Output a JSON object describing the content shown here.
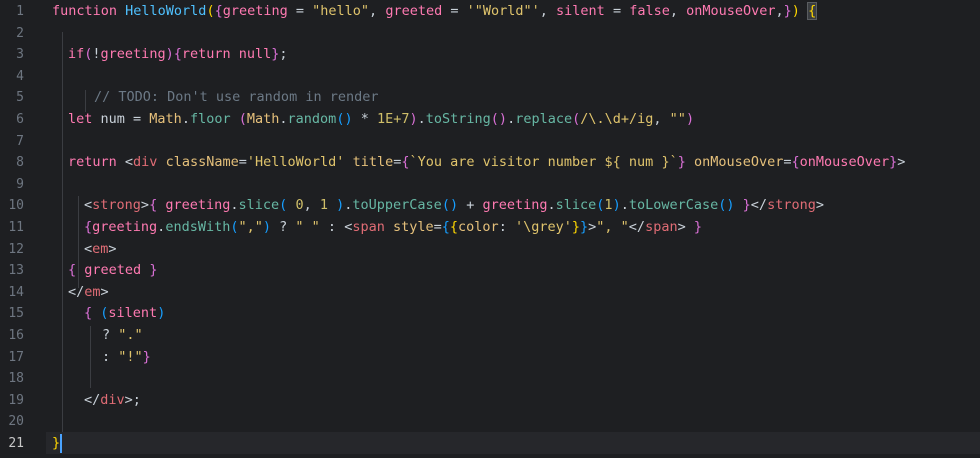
{
  "editor": {
    "language": "javascript",
    "active_line": 21,
    "line_numbers": [
      "1",
      "2",
      "3",
      "4",
      "5",
      "6",
      "7",
      "8",
      "9",
      "10",
      "11",
      "12",
      "13",
      "14",
      "15",
      "16",
      "17",
      "18",
      "19",
      "20",
      "21"
    ],
    "lines": [
      [
        [
          "kw",
          "function "
        ],
        [
          "fnname",
          "HelloWorld"
        ],
        [
          "br1",
          "("
        ],
        [
          "br2",
          "{"
        ],
        [
          "param",
          "greeting"
        ],
        [
          "plain",
          " = "
        ],
        [
          "str",
          "\"hello\""
        ],
        [
          "plain",
          ", "
        ],
        [
          "param",
          "greeted"
        ],
        [
          "plain",
          " = "
        ],
        [
          "str",
          "'\"World\"'"
        ],
        [
          "plain",
          ", "
        ],
        [
          "param",
          "silent"
        ],
        [
          "plain",
          " = "
        ],
        [
          "kw",
          "false"
        ],
        [
          "plain",
          ", "
        ],
        [
          "param",
          "onMouseOver"
        ],
        [
          "plain",
          ","
        ],
        [
          "br2",
          "}"
        ],
        [
          "br1",
          ")"
        ],
        [
          "plain",
          " "
        ],
        [
          "br1",
          "{"
        ]
      ],
      [],
      [
        [
          "kw",
          "if"
        ],
        [
          "br2",
          "("
        ],
        [
          "plain",
          "!"
        ],
        [
          "param",
          "greeting"
        ],
        [
          "br2",
          ")"
        ],
        [
          "br2",
          "{"
        ],
        [
          "kw",
          "return "
        ],
        [
          "kw",
          "null"
        ],
        [
          "br2",
          "}"
        ],
        [
          "plain",
          ";"
        ]
      ],
      [],
      [
        [
          "cmt",
          "// TODO: Don't use random in render"
        ]
      ],
      [
        [
          "kw",
          "let "
        ],
        [
          "plain",
          "num = "
        ],
        [
          "cls",
          "Math"
        ],
        [
          "plain",
          "."
        ],
        [
          "fn",
          "floor"
        ],
        [
          "plain",
          " "
        ],
        [
          "br2",
          "("
        ],
        [
          "cls",
          "Math"
        ],
        [
          "plain",
          "."
        ],
        [
          "fn",
          "random"
        ],
        [
          "br3",
          "()"
        ],
        [
          "plain",
          " * "
        ],
        [
          "num",
          "1E+7"
        ],
        [
          "br2",
          ")"
        ],
        [
          "plain",
          "."
        ],
        [
          "fn",
          "toString"
        ],
        [
          "br2",
          "()"
        ],
        [
          "plain",
          "."
        ],
        [
          "fn",
          "replace"
        ],
        [
          "br2",
          "("
        ],
        [
          "str",
          "/\\.\\d+/ig"
        ],
        [
          "plain",
          ", "
        ],
        [
          "str",
          "\"\""
        ],
        [
          "br2",
          ")"
        ]
      ],
      [],
      [
        [
          "kw",
          "return "
        ],
        [
          "plain",
          "<"
        ],
        [
          "tag",
          "div"
        ],
        [
          "plain",
          " "
        ],
        [
          "attr",
          "className"
        ],
        [
          "plain",
          "="
        ],
        [
          "str",
          "'HelloWorld'"
        ],
        [
          "plain",
          " "
        ],
        [
          "attr",
          "title"
        ],
        [
          "plain",
          "="
        ],
        [
          "br2",
          "{"
        ],
        [
          "str",
          "`You are visitor number ${ num }`"
        ],
        [
          "br2",
          "}"
        ],
        [
          "plain",
          " "
        ],
        [
          "attr",
          "onMouseOver"
        ],
        [
          "plain",
          "="
        ],
        [
          "br2",
          "{"
        ],
        [
          "param",
          "onMouseOver"
        ],
        [
          "br2",
          "}"
        ],
        [
          "plain",
          ">"
        ]
      ],
      [],
      [
        [
          "plain",
          "<"
        ],
        [
          "tag",
          "strong"
        ],
        [
          "plain",
          ">"
        ],
        [
          "br2",
          "{"
        ],
        [
          "plain",
          " "
        ],
        [
          "param",
          "greeting"
        ],
        [
          "plain",
          "."
        ],
        [
          "fn",
          "slice"
        ],
        [
          "br3",
          "("
        ],
        [
          "plain",
          " "
        ],
        [
          "num",
          "0"
        ],
        [
          "plain",
          ", "
        ],
        [
          "num",
          "1"
        ],
        [
          "plain",
          " "
        ],
        [
          "br3",
          ")"
        ],
        [
          "plain",
          "."
        ],
        [
          "fn",
          "toUpperCase"
        ],
        [
          "br3",
          "()"
        ],
        [
          "plain",
          " + "
        ],
        [
          "param",
          "greeting"
        ],
        [
          "plain",
          "."
        ],
        [
          "fn",
          "slice"
        ],
        [
          "br3",
          "("
        ],
        [
          "num",
          "1"
        ],
        [
          "br3",
          ")"
        ],
        [
          "plain",
          "."
        ],
        [
          "fn",
          "toLowerCase"
        ],
        [
          "br3",
          "()"
        ],
        [
          "plain",
          " "
        ],
        [
          "br2",
          "}"
        ],
        [
          "plain",
          "</"
        ],
        [
          "tag",
          "strong"
        ],
        [
          "plain",
          ">"
        ]
      ],
      [
        [
          "br2",
          "{"
        ],
        [
          "param",
          "greeting"
        ],
        [
          "plain",
          "."
        ],
        [
          "fn",
          "endsWith"
        ],
        [
          "br3",
          "("
        ],
        [
          "str",
          "\",\""
        ],
        [
          "br3",
          ")"
        ],
        [
          "plain",
          " ? "
        ],
        [
          "str",
          "\" \""
        ],
        [
          "plain",
          " : "
        ],
        [
          "plain",
          "<"
        ],
        [
          "tag",
          "span"
        ],
        [
          "plain",
          " "
        ],
        [
          "attr",
          "style"
        ],
        [
          "plain",
          "="
        ],
        [
          "br3",
          "{"
        ],
        [
          "br1",
          "{"
        ],
        [
          "attr",
          "color"
        ],
        [
          "plain",
          ": "
        ],
        [
          "str",
          "'\\grey'"
        ],
        [
          "br1",
          "}"
        ],
        [
          "br3",
          "}"
        ],
        [
          "plain",
          ">"
        ],
        [
          "str",
          "\", \""
        ],
        [
          "plain",
          "</"
        ],
        [
          "tag",
          "span"
        ],
        [
          "plain",
          "> "
        ],
        [
          "br2",
          "}"
        ]
      ],
      [
        [
          "plain",
          "<"
        ],
        [
          "tag",
          "em"
        ],
        [
          "plain",
          ">"
        ]
      ],
      [
        [
          "br2",
          "{"
        ],
        [
          "plain",
          " "
        ],
        [
          "param",
          "greeted"
        ],
        [
          "plain",
          " "
        ],
        [
          "br2",
          "}"
        ]
      ],
      [
        [
          "plain",
          "</"
        ],
        [
          "tag",
          "em"
        ],
        [
          "plain",
          ">"
        ]
      ],
      [
        [
          "br2",
          "{"
        ],
        [
          "plain",
          " "
        ],
        [
          "br3",
          "("
        ],
        [
          "param",
          "silent"
        ],
        [
          "br3",
          ")"
        ]
      ],
      [
        [
          "plain",
          "? "
        ],
        [
          "str",
          "\".\""
        ]
      ],
      [
        [
          "plain",
          ": "
        ],
        [
          "str",
          "\"!\""
        ],
        [
          "br2",
          "}"
        ]
      ],
      [],
      [
        [
          "plain",
          "</"
        ],
        [
          "tag",
          "div"
        ],
        [
          "plain",
          ">;"
        ]
      ],
      [],
      [
        [
          "br1",
          "}"
        ]
      ]
    ]
  }
}
